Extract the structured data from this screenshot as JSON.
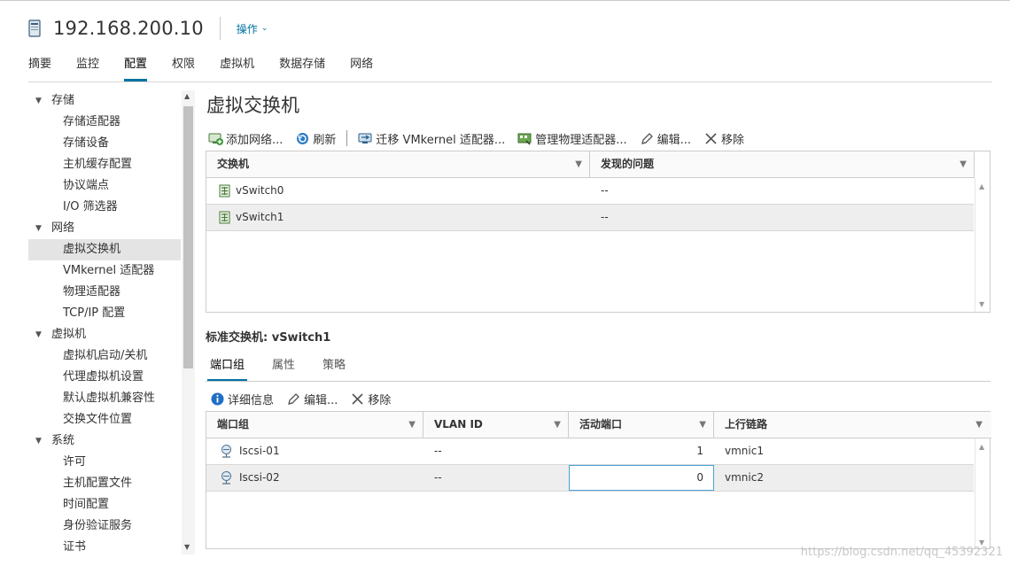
{
  "header": {
    "host_name": "192.168.200.10",
    "actions_label": "操作",
    "actions_chevron": "⌄"
  },
  "main_tabs": [
    "摘要",
    "监控",
    "配置",
    "权限",
    "虚拟机",
    "数据存储",
    "网络"
  ],
  "active_main_tab": "配置",
  "sidebar": {
    "groups": [
      {
        "label": "存储",
        "items": [
          "存储适配器",
          "存储设备",
          "主机缓存配置",
          "协议端点",
          "I/O 筛选器"
        ]
      },
      {
        "label": "网络",
        "items": [
          "虚拟交换机",
          "VMkernel 适配器",
          "物理适配器",
          "TCP/IP 配置"
        ]
      },
      {
        "label": "虚拟机",
        "items": [
          "虚拟机启动/关机",
          "代理虚拟机设置",
          "默认虚拟机兼容性",
          "交换文件位置"
        ]
      },
      {
        "label": "系统",
        "items": [
          "许可",
          "主机配置文件",
          "时间配置",
          "身份验证服务",
          "证书"
        ]
      }
    ],
    "selected_item": "虚拟交换机"
  },
  "section": {
    "title": "虚拟交换机",
    "toolbar": {
      "add_network": "添加网络...",
      "refresh": "刷新",
      "migrate_vmkernel": "迁移 VMkernel 适配器...",
      "manage_physical": "管理物理适配器...",
      "edit": "编辑...",
      "remove": "移除"
    },
    "switch_table": {
      "columns": [
        "交换机",
        "发现的问题"
      ],
      "rows": [
        {
          "name": "vSwitch0",
          "issues": "--"
        },
        {
          "name": "vSwitch1",
          "issues": "--"
        }
      ],
      "selected_row": 1
    }
  },
  "standard_switch": {
    "label": "标准交换机: vSwitch1",
    "tabs": [
      "端口组",
      "属性",
      "策略"
    ],
    "active_tab": "端口组",
    "toolbar": {
      "details": "详细信息",
      "edit": "编辑...",
      "remove": "移除"
    },
    "portgroup_table": {
      "columns": [
        "端口组",
        "VLAN ID",
        "活动端口",
        "上行链路"
      ],
      "rows": [
        {
          "name": "Iscsi-01",
          "vlan": "--",
          "active_ports": "1",
          "uplinks": "vmnic1"
        },
        {
          "name": "Iscsi-02",
          "vlan": "--",
          "active_ports": "0",
          "uplinks": "vmnic2"
        }
      ],
      "selected_row": 1
    }
  },
  "watermark": "https://blog.csdn.net/qq_45392321",
  "colors": {
    "accent": "#0072a3",
    "selected_row": "#eeeeee",
    "focus_outline": "#49a3d9"
  },
  "icons": {
    "host": "host-server-icon",
    "add_network": "add-network-icon",
    "refresh": "refresh-icon",
    "migrate": "migrate-vmkernel-icon",
    "manage_physical": "manage-physical-adapters-icon",
    "edit": "pencil-icon",
    "remove": "x-icon",
    "switch": "vswitch-icon",
    "portgroup": "portgroup-icon",
    "info": "info-icon",
    "filter": "filter-icon"
  }
}
